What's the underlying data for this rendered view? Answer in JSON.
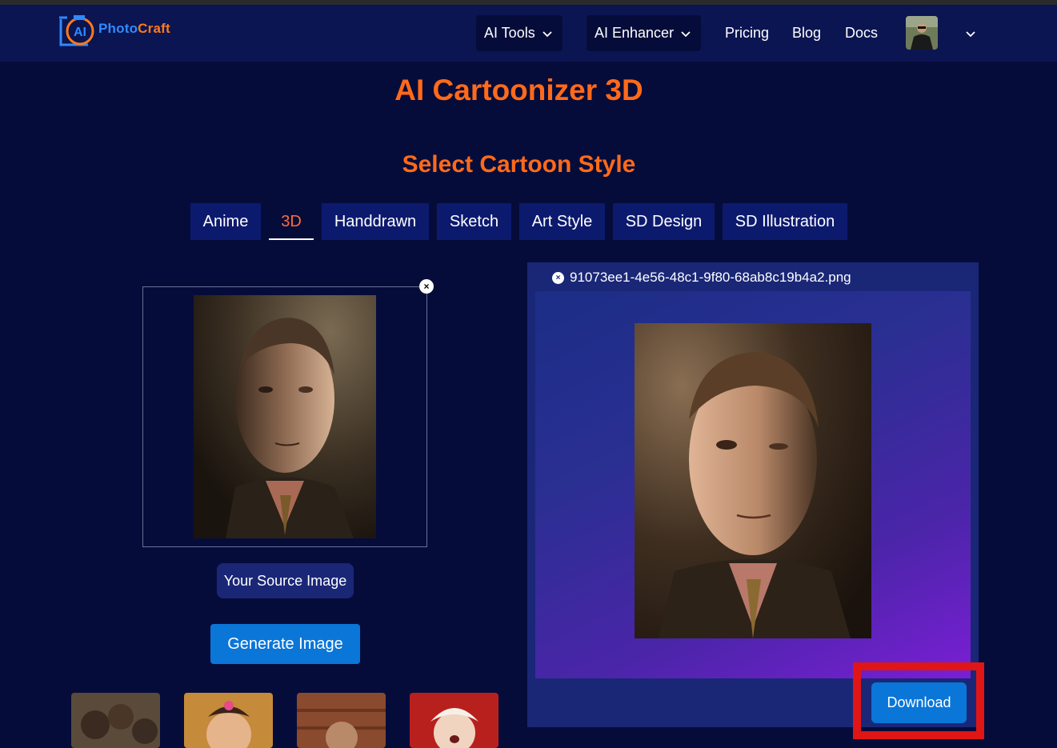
{
  "nav": {
    "logo_ai": "AI",
    "logo_photo": "Photo",
    "logo_craft": "Craft",
    "dropdowns": [
      {
        "label": "AI Tools"
      },
      {
        "label": "AI Enhancer"
      }
    ],
    "links": [
      {
        "label": "Pricing"
      },
      {
        "label": "Blog"
      },
      {
        "label": "Docs"
      }
    ]
  },
  "page": {
    "title": "AI Cartoonizer 3D",
    "section_title": "Select Cartoon Style"
  },
  "tabs": [
    {
      "label": "Anime",
      "active": false
    },
    {
      "label": "3D",
      "active": true
    },
    {
      "label": "Handdrawn",
      "active": false
    },
    {
      "label": "Sketch",
      "active": false
    },
    {
      "label": "Art Style",
      "active": false
    },
    {
      "label": "SD Design",
      "active": false
    },
    {
      "label": "SD Illustration",
      "active": false
    }
  ],
  "source": {
    "label": "Your Source Image",
    "generate_label": "Generate Image",
    "close_glyph": "×"
  },
  "result": {
    "filename": "91073ee1-4e56-48c1-9f80-68ab8c19b4a2.png",
    "close_glyph": "×",
    "download_label": "Download"
  },
  "colors": {
    "accent": "#ff6a1a",
    "navbar_bg": "#0b1552",
    "page_bg": "#060c3a",
    "button_blue": "#0a76d8",
    "highlight_red": "#e01515"
  }
}
